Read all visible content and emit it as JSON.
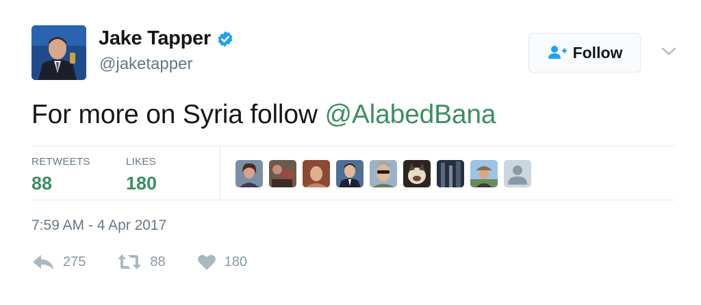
{
  "author": {
    "name": "Jake Tapper",
    "handle": "@jaketapper",
    "verified": true
  },
  "follow_button": {
    "label": "Follow",
    "icon": "add-user-icon"
  },
  "tweet": {
    "text_prefix": "For more on Syria follow ",
    "mention": "@AlabedBana"
  },
  "stats": {
    "retweets_label": "RETWEETS",
    "retweets_value": "88",
    "likes_label": "LIKES",
    "likes_value": "180"
  },
  "liker_avatars_count": 9,
  "timestamp": "7:59 AM - 4 Apr 2017",
  "actions": {
    "reply_count": "275",
    "retweet_count": "88",
    "like_count": "180"
  },
  "colors": {
    "accent_green": "#3b8f62",
    "verified_blue": "#1da1f2",
    "muted": "#657786",
    "icon_gray": "#aab8c2"
  }
}
